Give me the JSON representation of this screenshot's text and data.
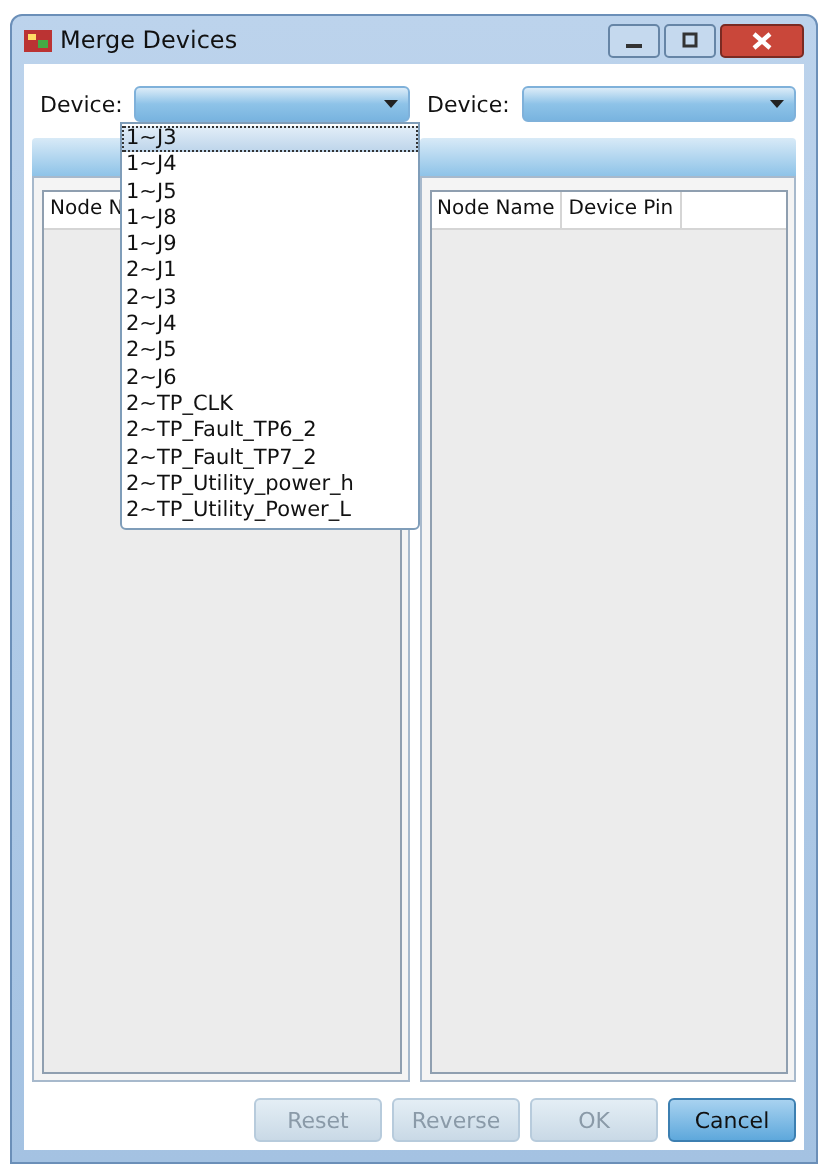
{
  "window": {
    "title": "Merge Devices"
  },
  "left": {
    "device_label": "Device:",
    "columns": [
      "Node N"
    ]
  },
  "right": {
    "device_label": "Device:",
    "columns": [
      "Node Name",
      "Device Pin"
    ]
  },
  "dropdown": {
    "items": [
      {
        "label": "1~J3",
        "selected": true
      },
      {
        "label": "1~J4",
        "selected": false
      },
      {
        "label": "1~J5",
        "selected": false
      },
      {
        "label": "1~J8",
        "selected": false
      },
      {
        "label": "1~J9",
        "selected": false
      },
      {
        "label": "2~J1",
        "selected": false
      },
      {
        "label": "2~J3",
        "selected": false
      },
      {
        "label": "2~J4",
        "selected": false
      },
      {
        "label": "2~J5",
        "selected": false
      },
      {
        "label": "2~J6",
        "selected": false
      },
      {
        "label": "2~TP_CLK",
        "selected": false
      },
      {
        "label": "2~TP_Fault_TP6_2",
        "selected": false
      },
      {
        "label": "2~TP_Fault_TP7_2",
        "selected": false
      },
      {
        "label": "2~TP_Utility_power_h",
        "selected": false
      },
      {
        "label": "2~TP_Utility_Power_L",
        "selected": false
      }
    ]
  },
  "buttons": [
    {
      "label": "Reset",
      "disabled": true
    },
    {
      "label": "Reverse",
      "disabled": true
    },
    {
      "label": "OK",
      "disabled": true
    },
    {
      "label": "Cancel",
      "disabled": false
    }
  ]
}
